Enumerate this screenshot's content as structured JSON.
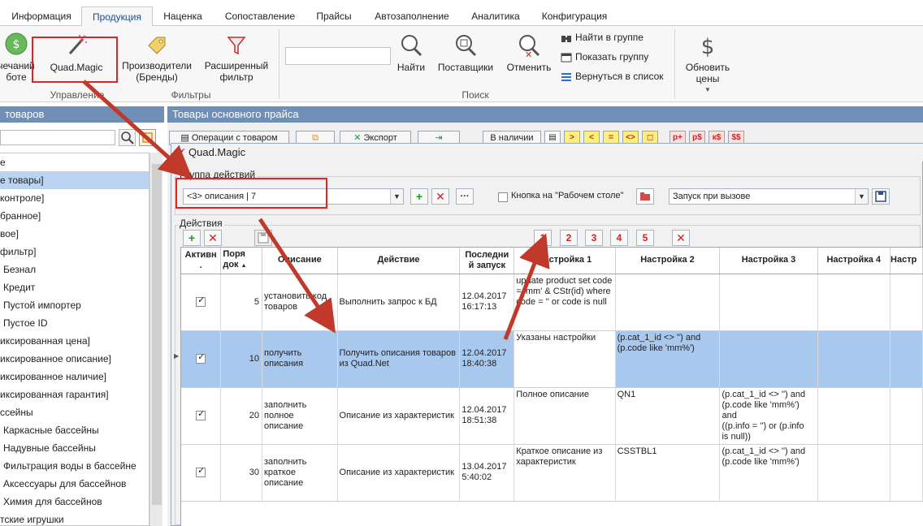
{
  "tabs": [
    "Информация",
    "Продукция",
    "Наценка",
    "Сопоставление",
    "Прайсы",
    "Автозаполнение",
    "Аналитика",
    "Конфигурация"
  ],
  "ribbon": {
    "btn_partial": "чечаний\nботе",
    "quad_magic": "Quad.Magic",
    "manufacturers": "Производители\n(Бренды)",
    "ext_filter": "Расширенный\nфильтр",
    "find": "Найти",
    "suppliers": "Поставщики",
    "cancel": "Отменить",
    "find_in_group": "Найти в группе",
    "show_group": "Показать группу",
    "back_to_list": "Вернуться в список",
    "refresh_prices": "Обновить\nцены",
    "group_management": "Управление",
    "group_filters": "Фильтры",
    "group_search": "Поиск"
  },
  "left": {
    "header": "товаров",
    "items": [
      {
        "label": "е",
        "indent": 0,
        "selected": false
      },
      {
        "label": "е товары]",
        "indent": 0,
        "selected": true
      },
      {
        "label": "контроле]",
        "indent": 0,
        "selected": false
      },
      {
        "label": "бранное]",
        "indent": 0,
        "selected": false
      },
      {
        "label": "вое]",
        "indent": 0,
        "selected": false
      },
      {
        "label": "фильтр]",
        "indent": 0,
        "selected": false
      },
      {
        "label": "Безнал",
        "indent": 1,
        "selected": false
      },
      {
        "label": "Кредит",
        "indent": 1,
        "selected": false
      },
      {
        "label": "Пустой импортер",
        "indent": 1,
        "selected": false
      },
      {
        "label": "Пустое ID",
        "indent": 1,
        "selected": false
      },
      {
        "label": "иксированная цена]",
        "indent": 0,
        "selected": false
      },
      {
        "label": "иксированное описание]",
        "indent": 0,
        "selected": false
      },
      {
        "label": "иксированное наличие]",
        "indent": 0,
        "selected": false
      },
      {
        "label": "иксированная гарантия]",
        "indent": 0,
        "selected": false
      },
      {
        "label": "ссейны",
        "indent": 0,
        "selected": false
      },
      {
        "label": "Каркасные бассейны",
        "indent": 1,
        "selected": false
      },
      {
        "label": "Надувные бассейны",
        "indent": 1,
        "selected": false
      },
      {
        "label": "Фильтрация воды в бассейне",
        "indent": 1,
        "selected": false
      },
      {
        "label": "Аксессуары для бассейнов",
        "indent": 1,
        "selected": false
      },
      {
        "label": "Химия для бассейнов",
        "indent": 1,
        "selected": false
      },
      {
        "label": "тские игрушки",
        "indent": 0,
        "selected": false
      }
    ]
  },
  "right": {
    "header": "Товары основного прайса",
    "ops_button": "Операции с товаром",
    "export_button": "Экспорт",
    "in_stock_button": "В наличии",
    "price_tags": [
      "р+",
      "р$",
      "к$",
      "$$"
    ]
  },
  "dialog": {
    "title": "Quad.Magic",
    "group_legend": "Группа действий",
    "group_value": "<3>  описания  |  7",
    "desktop_checkbox_label": "Кнопка на \"Рабочем столе\"",
    "run_mode_value": "Запуск при вызове",
    "actions_legend": "Действия",
    "setting_buttons": [
      "1",
      "2",
      "3",
      "4",
      "5"
    ]
  },
  "grid": {
    "columns": [
      "Активн\n.",
      "Поря\nдок",
      "Описание",
      "Действие",
      "Последни\nй запуск",
      "Настройка 1",
      "Настройка 2",
      "Настройка 3",
      "Настройка 4",
      "Настр"
    ],
    "rows": [
      {
        "active": true,
        "order": "5",
        "description": "установить код\nтоваров",
        "action": "Выполнить запрос к БД",
        "last_run": "12.04.2017\n16:17:13",
        "s1": "update product set code\n= 'mm' & CStr(id) where\ncode = '' or code is null",
        "s2": "",
        "s3": "",
        "s4": "",
        "selected": false
      },
      {
        "active": true,
        "order": "10",
        "description": "получить\nописания",
        "action": "Получить описания товаров\nиз Quad.Net",
        "last_run": "12.04.2017\n18:40:38",
        "s1": "Указаны настройки",
        "s2": "(p.cat_1_id <> '') and\n(p.code like 'mm%')",
        "s3": "",
        "s4": "",
        "selected": true
      },
      {
        "active": true,
        "order": "20",
        "description": "заполнить\nполное описание",
        "action": "Описание из характеристик",
        "last_run": "12.04.2017\n18:51:38",
        "s1": "Полное описание",
        "s2": "QN1",
        "s3": "(p.cat_1_id <> '') and\n(p.code like 'mm%') and\n((p.info = '') or (p.info\nis null))",
        "s4": "",
        "selected": false
      },
      {
        "active": true,
        "order": "30",
        "description": "заполнить\nкраткое\nописание",
        "action": "Описание из характеристик",
        "last_run": "13.04.2017\n5:40:02",
        "s1": "Краткое описание из\nхарактеристик",
        "s2": "CSSTBL1",
        "s3": "(p.cat_1_id <> '') and\n(p.code like 'mm%')",
        "s4": "",
        "selected": false
      }
    ]
  },
  "colors": {
    "accent_red": "#e02424",
    "selection": "#a9c8ee",
    "header_blue": "#6f8fb6"
  }
}
